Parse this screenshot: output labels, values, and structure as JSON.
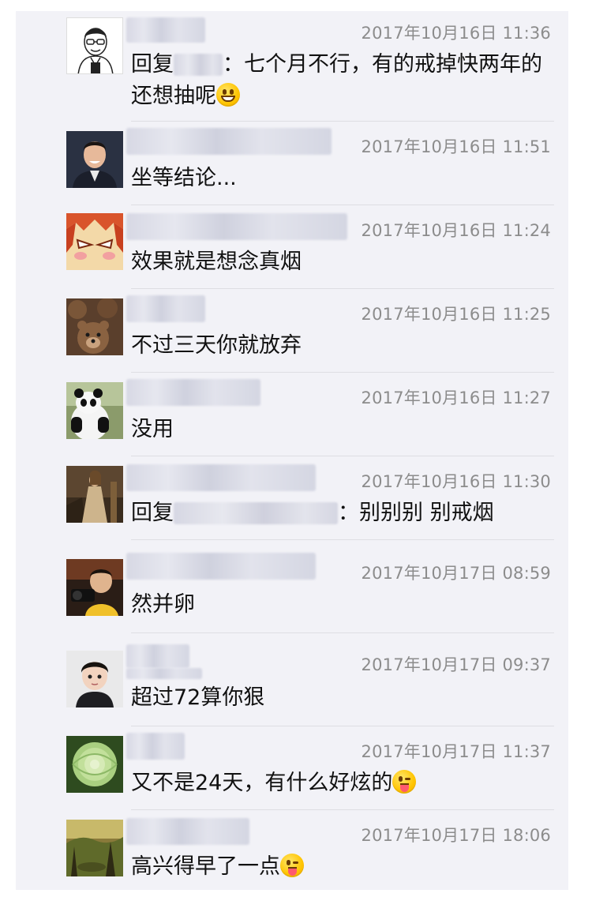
{
  "comments": [
    {
      "avatar": "cartoon-man-glasses-avatar",
      "time": "2017年10月16日 11:36",
      "reply_prefix": "回复",
      "text": "：七个月不行，有的戒掉快两年的还想抽呢",
      "emoji": "grinning-face-emoji"
    },
    {
      "avatar": "man-in-suit-avatar",
      "time": "2017年10月16日 11:51",
      "text": "坐等结论..."
    },
    {
      "avatar": "angry-anime-face-avatar",
      "time": "2017年10月16日 11:24",
      "text": "效果就是想念真烟"
    },
    {
      "avatar": "teddy-bears-avatar",
      "time": "2017年10月16日 11:25",
      "text": "不过三天你就放弃"
    },
    {
      "avatar": "panda-avatar",
      "time": "2017年10月16日 11:27",
      "text": "没用"
    },
    {
      "avatar": "painting-woman-avatar",
      "time": "2017年10月16日 11:30",
      "reply_prefix": "回复",
      "text": "：别别别 别戒烟"
    },
    {
      "avatar": "child-with-camera-avatar",
      "time": "2017年10月17日 08:59",
      "text": "然并卵"
    },
    {
      "avatar": "boy-portrait-avatar",
      "time": "2017年10月17日 09:37",
      "text": "超过72算你狠"
    },
    {
      "avatar": "green-flower-avatar",
      "time": "2017年10月17日 11:37",
      "text": "又不是24天，有什么好炫的",
      "emoji": "winking-tongue-emoji"
    },
    {
      "avatar": "forest-landscape-avatar",
      "time": "2017年10月17日 18:06",
      "text": "高兴得早了一点",
      "emoji": "winking-tongue-emoji"
    }
  ]
}
